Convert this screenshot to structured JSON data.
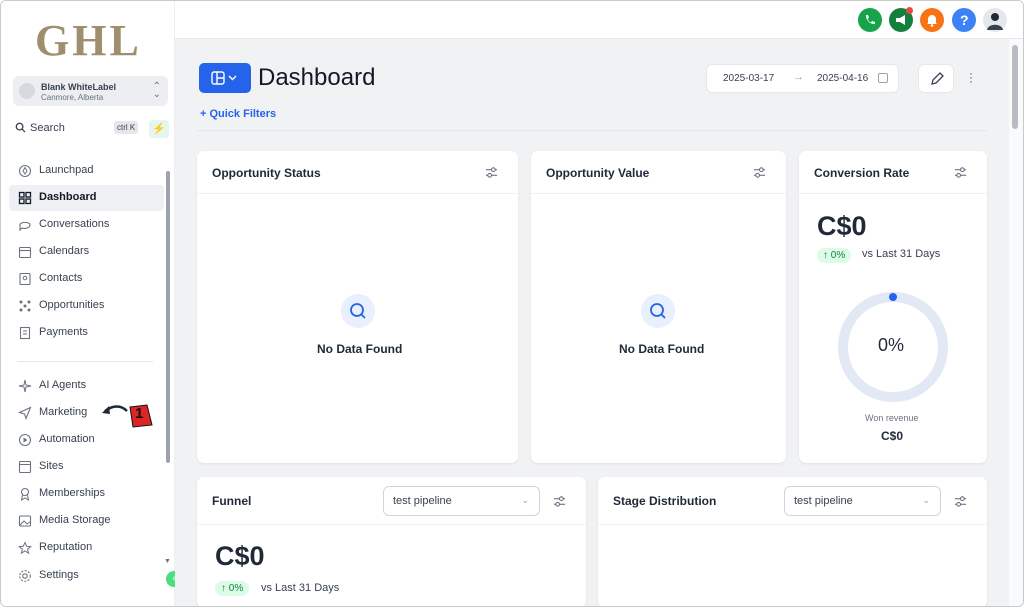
{
  "brand": {
    "logo_text": "GHL"
  },
  "account": {
    "name": "Blank WhiteLabel",
    "location": "Canmore, Alberta"
  },
  "search": {
    "label": "Search",
    "shortcut": "ctrl K"
  },
  "sidebar": {
    "items": [
      {
        "label": "Launchpad",
        "icon": "rocket-icon"
      },
      {
        "label": "Dashboard",
        "icon": "grid-icon"
      },
      {
        "label": "Conversations",
        "icon": "chat-icon"
      },
      {
        "label": "Calendars",
        "icon": "calendar-icon"
      },
      {
        "label": "Contacts",
        "icon": "contacts-icon"
      },
      {
        "label": "Opportunities",
        "icon": "opportunities-icon"
      },
      {
        "label": "Payments",
        "icon": "payments-icon"
      },
      {
        "label": "AI Agents",
        "icon": "sparkle-icon"
      },
      {
        "label": "Marketing",
        "icon": "send-icon"
      },
      {
        "label": "Automation",
        "icon": "automation-icon"
      },
      {
        "label": "Sites",
        "icon": "sites-icon"
      },
      {
        "label": "Memberships",
        "icon": "membership-icon"
      },
      {
        "label": "Media Storage",
        "icon": "image-icon"
      },
      {
        "label": "Reputation",
        "icon": "star-icon"
      },
      {
        "label": "Settings",
        "icon": "gear-icon"
      }
    ],
    "active": "Dashboard"
  },
  "annotation": {
    "step": "1"
  },
  "page": {
    "title": "Dashboard",
    "quick_filters": "+ Quick Filters"
  },
  "date_range": {
    "start": "2025-03-17",
    "end": "2025-04-16"
  },
  "cards": {
    "opportunity_status": {
      "title": "Opportunity Status",
      "empty": "No Data Found"
    },
    "opportunity_value": {
      "title": "Opportunity Value",
      "empty": "No Data Found"
    },
    "conversion_rate": {
      "title": "Conversion Rate",
      "value": "C$0",
      "change": "↑ 0%",
      "compare": "vs Last 31 Days",
      "gauge_label": "0%",
      "gauge_value": 0,
      "footer_label": "Won revenue",
      "footer_value": "C$0"
    },
    "funnel": {
      "title": "Funnel",
      "pipeline": "test pipeline",
      "value": "C$0",
      "change": "↑ 0%",
      "compare": "vs Last 31 Days"
    },
    "stage_distribution": {
      "title": "Stage Distribution",
      "pipeline": "test pipeline"
    }
  },
  "colors": {
    "primary": "#2563eb",
    "phone": "#16a34a",
    "announce": "#15803d",
    "bell": "#f97316",
    "help": "#3b82f6",
    "badge": "#dcfce7",
    "gauge_track": "#e2e8f4"
  }
}
